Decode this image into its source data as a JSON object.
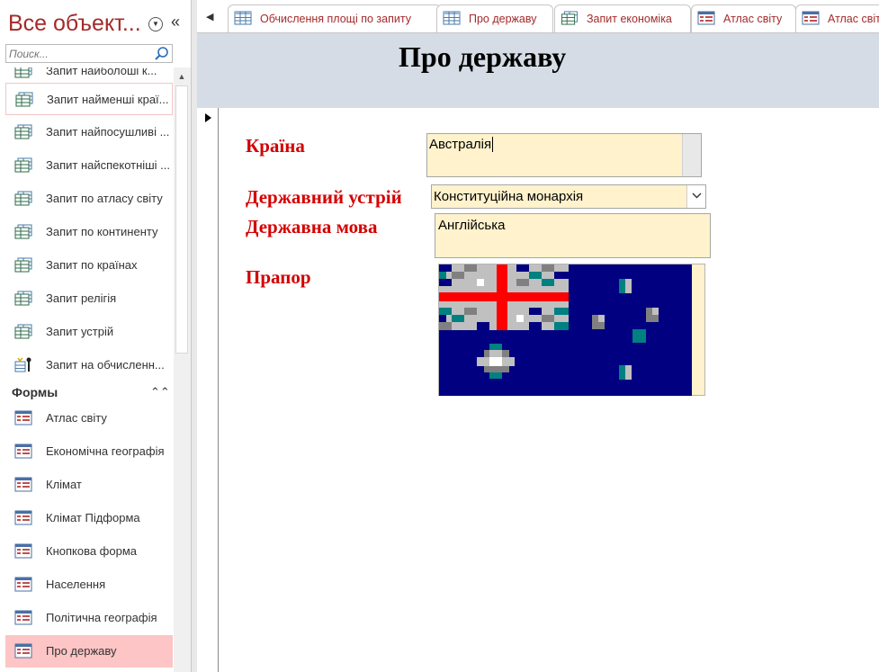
{
  "nav": {
    "title": "Все объект...",
    "search_placeholder": "Поиск...",
    "items_top": [
      {
        "label": "Запит найболоші к...",
        "icon": "query-icon"
      },
      {
        "label": "Запит найменші краї...",
        "icon": "query-icon"
      },
      {
        "label": "Запит найпосушливі ...",
        "icon": "query-icon"
      },
      {
        "label": "Запит найспекотніші ...",
        "icon": "query-icon"
      },
      {
        "label": "Запит по атласу світу",
        "icon": "query-icon"
      },
      {
        "label": "Запит по континенту",
        "icon": "query-icon"
      },
      {
        "label": "Запит по країнах",
        "icon": "query-icon"
      },
      {
        "label": "Запит релігія",
        "icon": "query-icon"
      },
      {
        "label": "Запит устрій",
        "icon": "query-icon"
      },
      {
        "label": "Запит на обчисленн...",
        "icon": "calc-query-icon"
      }
    ],
    "section_forms": "Формы",
    "forms": [
      {
        "label": "Атлас світу"
      },
      {
        "label": "Економічна географія"
      },
      {
        "label": "Клімат"
      },
      {
        "label": "Клімат Підформа"
      },
      {
        "label": "Кнопкова форма"
      },
      {
        "label": "Населення"
      },
      {
        "label": "Політична географія"
      },
      {
        "label": "Про державу"
      }
    ]
  },
  "tabs": [
    {
      "label": "Обчислення площі по запиту",
      "icon": "table-icon"
    },
    {
      "label": "Про державу",
      "icon": "table-icon"
    },
    {
      "label": "Запит економіка",
      "icon": "query-icon"
    },
    {
      "label": "Атлас світу",
      "icon": "form-icon"
    },
    {
      "label": "Атлас світ",
      "icon": "form-icon"
    }
  ],
  "form": {
    "title": "Про державу",
    "fields": {
      "country_label": "Країна",
      "country_value": "Австралія",
      "gov_label": "Державний устрій",
      "gov_value": "Конституційна монархія",
      "lang_label": "Державна мова",
      "lang_value": "Англійська",
      "flag_label": "Прапор"
    }
  },
  "colors": {
    "label_red": "#d40000",
    "field_bg": "#fff2cc",
    "header_bg": "#d5dce5",
    "selected_nav": "#fdc5c5"
  }
}
